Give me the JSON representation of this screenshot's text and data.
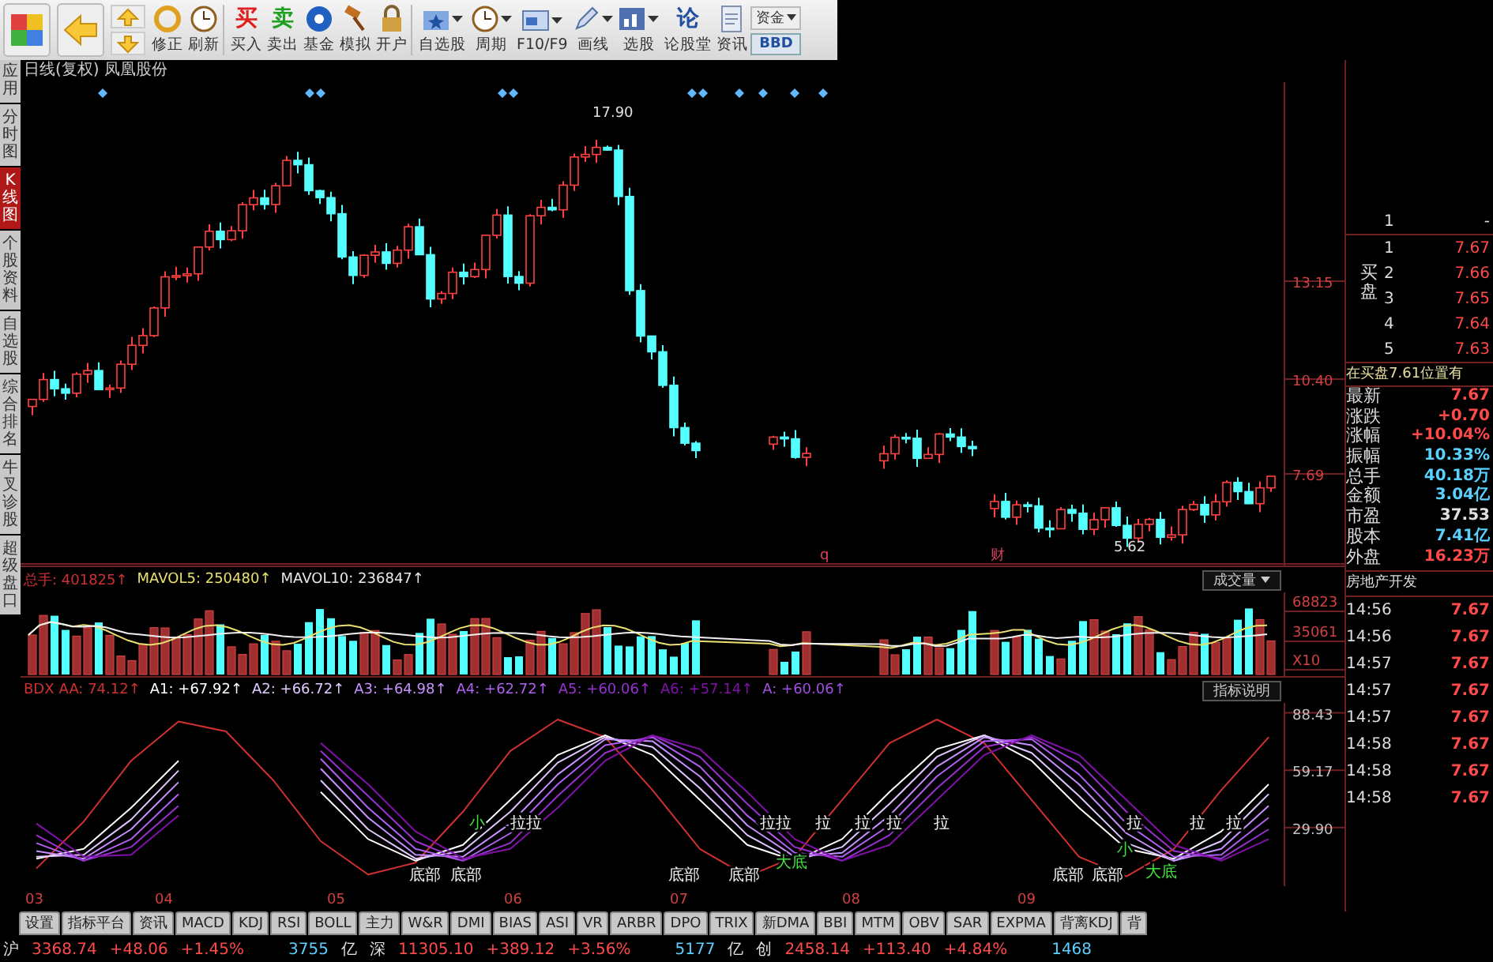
{
  "toolbar": {
    "buttons": [
      {
        "label": "修正",
        "dropdown": false
      },
      {
        "label": "刷新",
        "dropdown": false
      },
      {
        "label": "买入",
        "glyph": "买",
        "dropdown": false
      },
      {
        "label": "卖出",
        "glyph": "卖",
        "dropdown": false
      },
      {
        "label": "基金",
        "dropdown": false
      },
      {
        "label": "模拟",
        "dropdown": false
      },
      {
        "label": "开户",
        "dropdown": false
      },
      {
        "label": "自选股",
        "dropdown": true
      },
      {
        "label": "周期",
        "dropdown": true
      },
      {
        "label": "F10/F9",
        "dropdown": true
      },
      {
        "label": "画线",
        "dropdown": true
      },
      {
        "label": "选股",
        "dropdown": true
      },
      {
        "label": "论股堂",
        "glyph": "论",
        "dropdown": false
      },
      {
        "label": "资讯",
        "dropdown": false
      }
    ],
    "fund_select": "资金",
    "bbd_button": "BBD"
  },
  "side_tabs": [
    {
      "label": "应用",
      "selected": false
    },
    {
      "label": "分时图",
      "selected": false
    },
    {
      "label": "K线图",
      "selected": true
    },
    {
      "label": "个股资料",
      "selected": false
    },
    {
      "label": "自选股",
      "selected": false
    },
    {
      "label": "综合排名",
      "selected": false
    },
    {
      "label": "牛叉诊股",
      "selected": false
    },
    {
      "label": "超级盘口",
      "selected": false
    }
  ],
  "chart": {
    "title": "日线(复权) 凤凰股份",
    "price_axis": [
      "13.15",
      "10.40",
      "7.69"
    ],
    "high_label": "17.90",
    "low_label": "5.62",
    "event_marks": [
      "q",
      "财"
    ]
  },
  "volume": {
    "legend": [
      {
        "text": "总手: 401825↑",
        "color": "#d03030"
      },
      {
        "text": "MAVOL5: 250480↑",
        "color": "#e8e070"
      },
      {
        "text": "MAVOL10: 236847↑",
        "color": "#e8e8e8"
      }
    ],
    "dropdown": "成交量",
    "axis": [
      "68823",
      "35061",
      "X10"
    ]
  },
  "indicator": {
    "name": "BDX",
    "legend_values": [
      ": 74.12↑",
      ": +67.92↑",
      ": +66.72↑",
      ": +64.98↑",
      ": +62.72↑",
      ": +60.06↑",
      ": +57.14↑"
    ],
    "extra_legend": [
      {
        "text": "A: +60.06↑",
        "color": "#a050e0"
      }
    ],
    "button": "指标说明",
    "chart_data": {
      "type": "line",
      "ylim": [
        0,
        93.5
      ],
      "yticks": [
        {
          "value": 88.43,
          "label": "88.43"
        },
        {
          "value": 59.17,
          "label": "59.17"
        },
        {
          "value": 29.9,
          "label": "29.90"
        }
      ],
      "series": [
        {
          "name": "AA",
          "color": "#d03030",
          "values": [
            9,
            33,
            64,
            84,
            79,
            54,
            23,
            6,
            12,
            38,
            69,
            85,
            76,
            49,
            19,
            5,
            15,
            44,
            73,
            85,
            73,
            44,
            15,
            5,
            19,
            49,
            76
          ]
        },
        {
          "name": "A1",
          "color": "#ffffff",
          "values": [
            14,
            19,
            40,
            64,
            null,
            null,
            48,
            24,
            13,
            21,
            44,
            67,
            77,
            67,
            44,
            21,
            13,
            24,
            48,
            70,
            77,
            64,
            40,
            19,
            14,
            28,
            52
          ]
        },
        {
          "name": "A2",
          "color": "#e0c8ff",
          "values": [
            15,
            16,
            34,
            59,
            null,
            null,
            54,
            29,
            14,
            18,
            38,
            63,
            76,
            71,
            50,
            26,
            13,
            20,
            42,
            66,
            77,
            68,
            46,
            22,
            13,
            23,
            47
          ]
        },
        {
          "name": "A3",
          "color": "#c890ff",
          "values": [
            18,
            14,
            29,
            53,
            null,
            null,
            60,
            35,
            16,
            15,
            32,
            57,
            75,
            74,
            56,
            31,
            15,
            17,
            36,
            61,
            76,
            72,
            52,
            27,
            13,
            19,
            41
          ]
        },
        {
          "name": "A4",
          "color": "#b060f0",
          "values": [
            22,
            13,
            24,
            47,
            null,
            null,
            65,
            40,
            19,
            13,
            27,
            52,
            72,
            76,
            61,
            36,
            17,
            15,
            31,
            56,
            74,
            75,
            57,
            32,
            15,
            16,
            35
          ]
        },
        {
          "name": "A5",
          "color": "#9a30d0",
          "values": [
            26,
            13,
            20,
            41,
            null,
            null,
            69,
            46,
            23,
            13,
            22,
            46,
            68,
            77,
            66,
            42,
            20,
            13,
            26,
            50,
            71,
            76,
            63,
            38,
            18,
            14,
            29
          ]
        },
        {
          "name": "A6",
          "color": "#8010a8",
          "values": [
            32,
            15,
            16,
            36,
            null,
            null,
            73,
            52,
            28,
            14,
            19,
            40,
            64,
            77,
            70,
            48,
            24,
            13,
            21,
            44,
            67,
            77,
            67,
            44,
            21,
            13,
            24
          ]
        }
      ]
    },
    "annotations": [
      {
        "text": "小",
        "color": "#40e040"
      },
      {
        "text": "拉拉",
        "color": "#f0f0f0"
      },
      {
        "text": "底部",
        "color": "#f0f0f0"
      },
      {
        "text": "底部",
        "color": "#f0f0f0"
      },
      {
        "text": "底部",
        "color": "#f0f0f0"
      },
      {
        "text": "底部",
        "color": "#f0f0f0"
      },
      {
        "text": "大底",
        "color": "#40e040"
      },
      {
        "text": "拉拉",
        "color": "#f0f0f0"
      },
      {
        "text": "拉",
        "color": "#f0f0f0"
      },
      {
        "text": "拉",
        "color": "#f0f0f0"
      },
      {
        "text": "拉",
        "color": "#f0f0f0"
      },
      {
        "text": "拉",
        "color": "#f0f0f0"
      },
      {
        "text": "底部",
        "color": "#f0f0f0"
      },
      {
        "text": "底部",
        "color": "#f0f0f0"
      },
      {
        "text": "大底",
        "color": "#40e040"
      },
      {
        "text": "小",
        "color": "#40e040"
      },
      {
        "text": "拉",
        "color": "#f0f0f0"
      },
      {
        "text": "拉",
        "color": "#f0f0f0"
      },
      {
        "text": "拉",
        "color": "#f0f0f0"
      }
    ]
  },
  "dates": [
    "03",
    "04",
    "05",
    "06",
    "07",
    "08",
    "09"
  ],
  "quote": {
    "sell": [
      {
        "level": "1",
        "price": "-"
      }
    ],
    "buy_label": "买盘",
    "buy": [
      {
        "level": "1",
        "price": "7.67"
      },
      {
        "level": "2",
        "price": "7.66"
      },
      {
        "level": "3",
        "price": "7.65"
      },
      {
        "level": "4",
        "price": "7.64"
      },
      {
        "level": "5",
        "price": "7.63"
      }
    ],
    "notice": "在买盘7.61位置有",
    "stats": [
      {
        "label": "最新",
        "value": "7.67",
        "color": "#ff4a4a"
      },
      {
        "label": "涨跌",
        "value": "+0.70",
        "color": "#ff4a4a"
      },
      {
        "label": "涨幅",
        "value": "+10.04%",
        "color": "#ff4a4a"
      },
      {
        "label": "振幅",
        "value": "10.33%",
        "color": "#5ad0ff"
      },
      {
        "label": "总手",
        "value": "40.18万",
        "color": "#5ad0ff"
      },
      {
        "label": "金额",
        "value": "3.04亿",
        "color": "#5ad0ff"
      },
      {
        "label": "市盈",
        "value": "37.53",
        "color": "#e0e0e0"
      },
      {
        "label": "股本",
        "value": "7.41亿",
        "color": "#5ad0ff"
      },
      {
        "label": "外盘",
        "value": "16.23万",
        "color": "#ff4a4a"
      }
    ],
    "industry": "房地产开发",
    "ticks": [
      {
        "time": "14:56",
        "price": "7.67"
      },
      {
        "time": "14:56",
        "price": "7.67"
      },
      {
        "time": "14:57",
        "price": "7.67"
      },
      {
        "time": "14:57",
        "price": "7.67"
      },
      {
        "time": "14:57",
        "price": "7.67"
      },
      {
        "time": "14:58",
        "price": "7.67"
      },
      {
        "time": "14:58",
        "price": "7.67"
      },
      {
        "time": "14:58",
        "price": "7.67"
      }
    ]
  },
  "bottom_tabs": [
    "设置",
    "指标平台",
    "资讯",
    "MACD",
    "KDJ",
    "RSI",
    "BOLL",
    "主力",
    "W&R",
    "DMI",
    "BIAS",
    "ASI",
    "VR",
    "ARBR",
    "DPO",
    "TRIX",
    "新DMA",
    "BBI",
    "MTM",
    "OBV",
    "SAR",
    "EXPMA",
    "背离KDJ",
    "背"
  ],
  "status_bar": [
    {
      "text": "沪",
      "color": "#e0e0e0"
    },
    {
      "text": "3368.74",
      "color": "#ff4a4a"
    },
    {
      "text": "+48.06",
      "color": "#ff4a4a"
    },
    {
      "text": "+1.45%",
      "color": "#ff4a4a"
    },
    {
      "text": "3755",
      "color": "#5ad0ff"
    },
    {
      "text": "亿",
      "color": "#e0e0e0"
    },
    {
      "text": "深",
      "color": "#e0e0e0"
    },
    {
      "text": "11305.10",
      "color": "#ff4a4a"
    },
    {
      "text": "+389.12",
      "color": "#ff4a4a"
    },
    {
      "text": "+3.56%",
      "color": "#ff4a4a"
    },
    {
      "text": "5177",
      "color": "#5ad0ff"
    },
    {
      "text": "亿",
      "color": "#e0e0e0"
    },
    {
      "text": "创",
      "color": "#e0e0e0"
    },
    {
      "text": "2458.14",
      "color": "#ff4a4a"
    },
    {
      "text": "+113.40",
      "color": "#ff4a4a"
    },
    {
      "text": "+4.84%",
      "color": "#ff4a4a"
    },
    {
      "text": "1468",
      "color": "#5ad0ff"
    }
  ]
}
